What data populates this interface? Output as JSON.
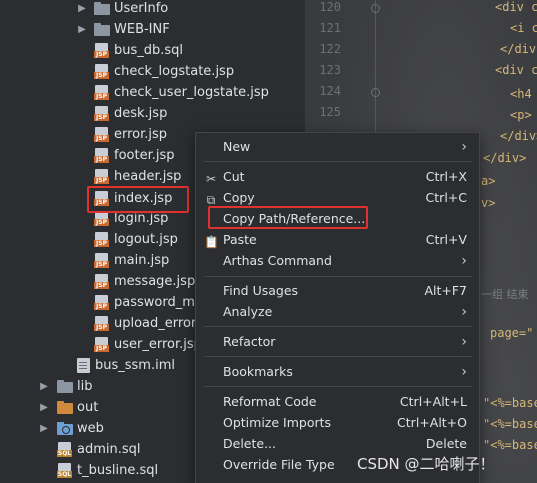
{
  "tree": {
    "items": [
      {
        "label": "UserInfo",
        "icon": "folder-icon",
        "expandable": true
      },
      {
        "label": "WEB-INF",
        "icon": "folder-icon",
        "expandable": true
      },
      {
        "label": "bus_db.sql",
        "icon": "jsp-file-icon"
      },
      {
        "label": "check_logstate.jsp",
        "icon": "jsp-file-icon"
      },
      {
        "label": "check_user_logstate.jsp",
        "icon": "jsp-file-icon"
      },
      {
        "label": "desk.jsp",
        "icon": "jsp-file-icon"
      },
      {
        "label": "error.jsp",
        "icon": "jsp-file-icon"
      },
      {
        "label": "footer.jsp",
        "icon": "jsp-file-icon"
      },
      {
        "label": "header.jsp",
        "icon": "jsp-file-icon"
      },
      {
        "label": "index.jsp",
        "icon": "jsp-file-icon",
        "selected": true
      },
      {
        "label": "login.jsp",
        "icon": "jsp-file-icon"
      },
      {
        "label": "logout.jsp",
        "icon": "jsp-file-icon"
      },
      {
        "label": "main.jsp",
        "icon": "jsp-file-icon"
      },
      {
        "label": "message.jsp",
        "icon": "jsp-file-icon"
      },
      {
        "label": "password_mo",
        "icon": "jsp-file-icon"
      },
      {
        "label": "upload_error",
        "icon": "jsp-file-icon"
      },
      {
        "label": "user_error.jsp",
        "icon": "jsp-file-icon"
      },
      {
        "label": "bus_ssm.iml",
        "icon": "iml-file-icon"
      },
      {
        "label": "lib",
        "icon": "folder-icon",
        "expandable": true
      },
      {
        "label": "out",
        "icon": "folder-icon",
        "expandable": true,
        "color": "#d08a3e"
      },
      {
        "label": "web",
        "icon": "web-folder-icon",
        "expandable": true
      },
      {
        "label": "admin.sql",
        "icon": "sql-file-icon"
      },
      {
        "label": "t_busline.sql",
        "icon": "sql-file-icon"
      }
    ]
  },
  "editor": {
    "line_numbers": [
      "120",
      "121",
      "122",
      "123",
      "124",
      "125"
    ],
    "code_lines": [
      "<div c",
      "<i c",
      "</div",
      "<div c",
      "<h4",
      "<p>"
    ],
    "trailing": [
      "</div>",
      "</div>",
      "a>",
      "v>"
    ],
    "comment": "一组 结束",
    "attr_fragment": "page=\"",
    "base_fragments": [
      "\"<%=base",
      "\"<%=base",
      "\"<%=base"
    ]
  },
  "menu": {
    "items": [
      {
        "label": "New",
        "submenu": true
      },
      {
        "label": "Cut",
        "shortcut": "Ctrl+X",
        "icon": "scissors-icon"
      },
      {
        "label": "Copy",
        "shortcut": "Ctrl+C",
        "icon": "copy-icon"
      },
      {
        "label": "Copy Path/Reference...",
        "highlighted": true
      },
      {
        "label": "Paste",
        "shortcut": "Ctrl+V",
        "icon": "clipboard-icon"
      },
      {
        "label": "Arthas Command",
        "submenu": true
      },
      {
        "label": "Find Usages",
        "shortcut": "Alt+F7"
      },
      {
        "label": "Analyze",
        "submenu": true
      },
      {
        "label": "Refactor",
        "submenu": true
      },
      {
        "label": "Bookmarks",
        "submenu": true
      },
      {
        "label": "Reformat Code",
        "shortcut": "Ctrl+Alt+L"
      },
      {
        "label": "Optimize Imports",
        "shortcut": "Ctrl+Alt+O"
      },
      {
        "label": "Delete...",
        "shortcut": "Delete"
      },
      {
        "label": "Override File Type"
      }
    ]
  },
  "watermark": "CSDN @二哈喇子！",
  "colors": {
    "highlight_border": "#e0332e",
    "accent_folder": "#d08a3e"
  }
}
